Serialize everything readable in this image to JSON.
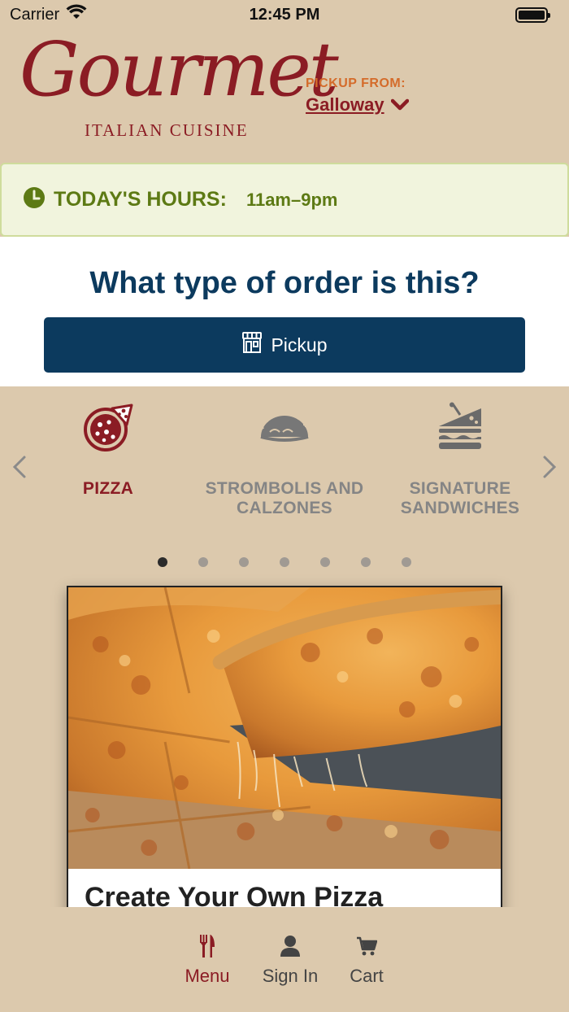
{
  "status_bar": {
    "carrier": "Carrier",
    "time": "12:45 PM"
  },
  "header": {
    "logo_script": "Gourmet",
    "logo_subtitle": "ITALIAN CUISINE",
    "pickup_from_label": "PICKUP FROM:",
    "location": "Galloway"
  },
  "hours": {
    "label": "TODAY'S HOURS:",
    "value": "11am–9pm"
  },
  "order": {
    "title": "What type of order is this?",
    "pickup_label": "Pickup"
  },
  "categories": [
    {
      "label": "PIZZA",
      "icon": "pizza-icon",
      "active": true
    },
    {
      "label": "STROMBOLIS AND CALZONES",
      "icon": "calzone-icon",
      "active": false
    },
    {
      "label": "SIGNATURE SANDWICHES",
      "icon": "sandwich-icon",
      "active": false
    }
  ],
  "carousel": {
    "page_count": 7,
    "active_page": 1
  },
  "card": {
    "title": "Create Your Own Pizza"
  },
  "tabbar": {
    "items": [
      {
        "label": "Menu",
        "icon": "fork-knife-icon",
        "active": true
      },
      {
        "label": "Sign In",
        "icon": "user-icon",
        "active": false
      },
      {
        "label": "Cart",
        "icon": "cart-icon",
        "active": false
      }
    ]
  },
  "colors": {
    "background": "#dcc9ad",
    "brand_red": "#8b1c24",
    "navy": "#0c3a5e",
    "hours_green": "#5d7a14",
    "pickup_orange": "#d46b2a"
  }
}
